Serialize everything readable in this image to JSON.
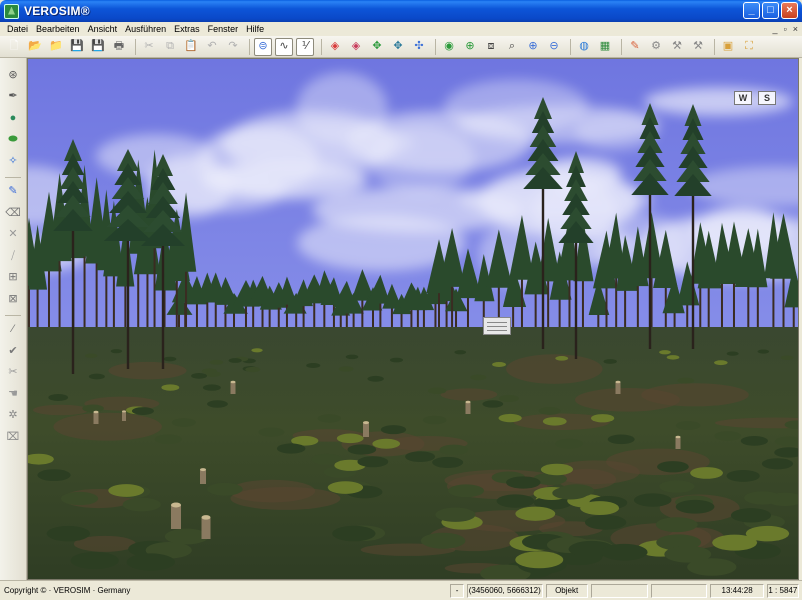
{
  "window": {
    "title": "VEROSIM®",
    "controls": {
      "minimize": "_",
      "maximize": "□",
      "close": "×"
    }
  },
  "menu": {
    "items": [
      "Datei",
      "Bearbeiten",
      "Ansicht",
      "Ausführen",
      "Extras",
      "Fenster",
      "Hilfe"
    ],
    "mdi_controls": {
      "minimize": "_",
      "restore": "▫",
      "close": "×"
    }
  },
  "toolbar": {
    "groups": [
      [
        {
          "icon": "new-document-icon",
          "glyph": "🗋",
          "color": "#ffffff"
        },
        {
          "icon": "open-folder-icon",
          "glyph": "📂",
          "color": "#e8b83a"
        },
        {
          "icon": "open-project-icon",
          "glyph": "📁",
          "color": "#d89a3a"
        },
        {
          "icon": "save-icon",
          "glyph": "💾",
          "color": "#3a5fc8"
        },
        {
          "icon": "save-all-icon",
          "glyph": "💾",
          "color": "#3a5fc8"
        },
        {
          "icon": "print-icon",
          "glyph": "🖶",
          "color": "#666666"
        }
      ],
      [
        {
          "icon": "cut-icon",
          "glyph": "✂",
          "color": "#b0b0b0"
        },
        {
          "icon": "copy-icon",
          "glyph": "⧉",
          "color": "#b0b0b0"
        },
        {
          "icon": "paste-icon",
          "glyph": "📋",
          "color": "#b0b0b0"
        },
        {
          "icon": "undo-icon",
          "glyph": "↶",
          "color": "#b0b0b0"
        },
        {
          "icon": "redo-icon",
          "glyph": "↷",
          "color": "#b0b0b0"
        }
      ],
      [
        {
          "icon": "link-icon",
          "glyph": "⊜",
          "color": "#3a6fd8",
          "pressed": true
        },
        {
          "icon": "angle-tool-icon",
          "glyph": "∿",
          "color": "#444444",
          "pressed": true
        },
        {
          "icon": "scale-tool-icon",
          "glyph": "⅟",
          "color": "#444444",
          "pressed": true
        }
      ],
      [
        {
          "icon": "cube-red-icon",
          "glyph": "◈",
          "color": "#d83a3a"
        },
        {
          "icon": "cube-red-alt-icon",
          "glyph": "◈",
          "color": "#c83a5a"
        },
        {
          "icon": "move-icon",
          "glyph": "✥",
          "color": "#2a9a3a"
        },
        {
          "icon": "rotate-move-icon",
          "glyph": "✥",
          "color": "#2a7a9a"
        },
        {
          "icon": "pivot-icon",
          "glyph": "✣",
          "color": "#3a6fd8"
        }
      ],
      [
        {
          "icon": "select-dot-icon",
          "glyph": "◉",
          "color": "#2a9a3a"
        },
        {
          "icon": "zoom-in-icon",
          "glyph": "⊕",
          "color": "#2a9a3a"
        },
        {
          "icon": "zoom-region-icon",
          "glyph": "⧈",
          "color": "#444444"
        },
        {
          "icon": "zoom-window-icon",
          "glyph": "⌕",
          "color": "#444444"
        },
        {
          "icon": "zoom-plus-icon",
          "glyph": "⊕",
          "color": "#3a6fd8"
        },
        {
          "icon": "zoom-minus-icon",
          "glyph": "⊖",
          "color": "#3a6fd8"
        }
      ],
      [
        {
          "icon": "globe-icon",
          "glyph": "◍",
          "color": "#2a7ad8"
        },
        {
          "icon": "map-icon",
          "glyph": "▦",
          "color": "#2a8a3a"
        }
      ],
      [
        {
          "icon": "camera-icon",
          "glyph": "✎",
          "color": "#d8603a"
        },
        {
          "icon": "camera-view-icon",
          "glyph": "⚙",
          "color": "#888888"
        },
        {
          "icon": "tool-icon",
          "glyph": "⚒",
          "color": "#888888"
        },
        {
          "icon": "tool-alt-icon",
          "glyph": "⚒",
          "color": "#888888"
        }
      ],
      [
        {
          "icon": "layout-icon",
          "glyph": "▣",
          "color": "#d8a03a"
        },
        {
          "icon": "frame-icon",
          "glyph": "⛶",
          "color": "#d8a03a"
        }
      ]
    ]
  },
  "left_toolbar": {
    "items": [
      {
        "icon": "camera-tripod-icon",
        "glyph": "⊛",
        "color": "#555555"
      },
      {
        "icon": "brush-icon",
        "glyph": "✒",
        "color": "#555555"
      },
      {
        "icon": "globe-green-icon",
        "glyph": "●",
        "color": "#2a8a5a"
      },
      {
        "icon": "terrain-icon",
        "glyph": "⬬",
        "color": "#3a9a3a"
      },
      {
        "icon": "navigate-icon",
        "glyph": "✧",
        "color": "#2a6ad8"
      },
      {
        "sep": true
      },
      {
        "icon": "pencil-icon",
        "glyph": "✎",
        "color": "#3a6ad8"
      },
      {
        "icon": "eraser-icon",
        "glyph": "⌫",
        "color": "#777777"
      },
      {
        "icon": "cross-icon",
        "glyph": "✕",
        "color": "#999999"
      },
      {
        "icon": "split-icon",
        "glyph": "⧸",
        "color": "#999999"
      },
      {
        "icon": "align-icon",
        "glyph": "⊞",
        "color": "#777777"
      },
      {
        "icon": "distribute-icon",
        "glyph": "⊠",
        "color": "#777777"
      },
      {
        "sep": true
      },
      {
        "icon": "knife-icon",
        "glyph": "⁄",
        "color": "#777777"
      },
      {
        "icon": "check-edit-icon",
        "glyph": "✔",
        "color": "#777777"
      },
      {
        "icon": "scissors-icon",
        "glyph": "✂",
        "color": "#999999"
      },
      {
        "icon": "hand-icon",
        "glyph": "☚",
        "color": "#999999"
      },
      {
        "icon": "settings-icon",
        "glyph": "✲",
        "color": "#888888"
      },
      {
        "icon": "trash-icon",
        "glyph": "⌧",
        "color": "#888888"
      }
    ]
  },
  "viewport": {
    "compass": {
      "west": "W",
      "south": "S"
    },
    "colors": {
      "sky": "#7d84e8",
      "cloud": "#ffffff",
      "ground": "#3c4a2c",
      "canopy": "#2a4a2c",
      "trunk": "#3a2c22"
    }
  },
  "status": {
    "copyright": "Copyright © · VEROSIM · Germany",
    "cells": [
      "-",
      "(3456060, 5666312)",
      "Objekt",
      "",
      "",
      "13:44:28",
      "1 : 5847"
    ]
  }
}
